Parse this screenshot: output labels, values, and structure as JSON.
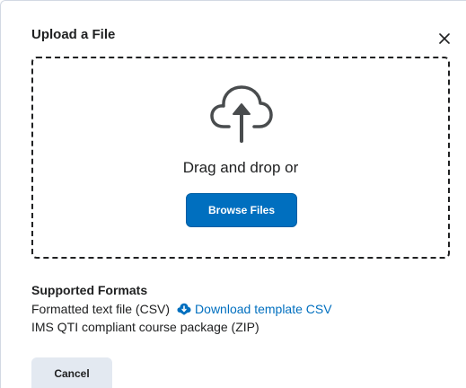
{
  "dialog": {
    "title": "Upload a File",
    "close_icon": "close-icon"
  },
  "dropzone": {
    "icon": "cloud-upload-icon",
    "prompt": "Drag and drop or",
    "browse_label": "Browse Files"
  },
  "formats": {
    "heading": "Supported Formats",
    "items": [
      {
        "label": "Formatted text file (CSV)",
        "link_icon": "cloud-download-icon",
        "link_label": "Download template CSV"
      },
      {
        "label": "IMS QTI compliant course package (ZIP)"
      }
    ]
  },
  "footer": {
    "cancel_label": "Cancel"
  },
  "colors": {
    "primary": "#006fbf",
    "text": "#202122",
    "secondary_button": "#e3e9f1"
  }
}
